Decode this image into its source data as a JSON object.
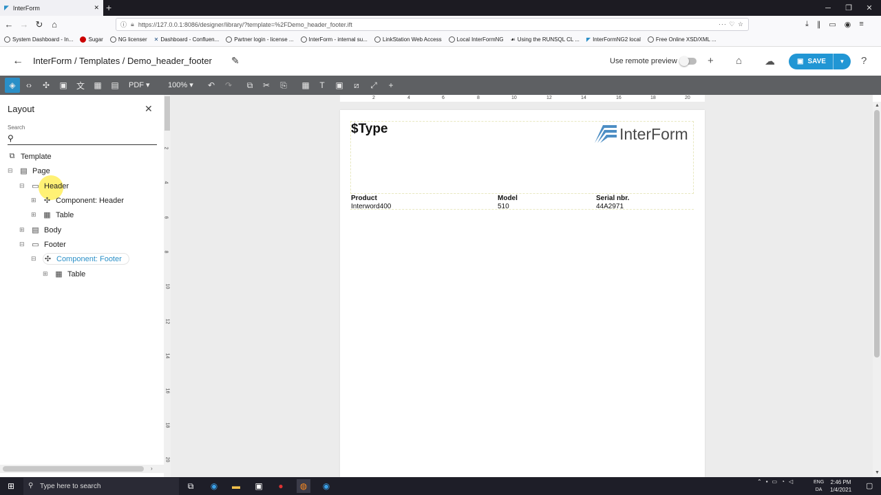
{
  "browser": {
    "tab_title": "InterForm",
    "url": "https://127.0.0.1:8086/designer/library/?template=%2FDemo_header_footer.ift",
    "bookmarks": [
      "System Dashboard - In...",
      "Sugar",
      "NG licenser",
      "Dashboard - Confluen...",
      "Partner login - license ...",
      "InterForm - internal su...",
      "LinkStation Web Access",
      "Local InterFormNG",
      "Using the RUNSQL CL ...",
      "InterFormNG2 local",
      "Free Online XSD/XML ..."
    ]
  },
  "app": {
    "breadcrumb": "InterForm / Templates / Demo_header_footer",
    "remote_preview_label": "Use remote preview",
    "remote_preview_on": false,
    "save_label": "SAVE",
    "accent_color": "#2196d4"
  },
  "toolbar": {
    "format": "PDF",
    "zoom": "100%"
  },
  "layout_panel": {
    "title": "Layout",
    "search_label": "Search",
    "tree": {
      "template": "Template",
      "page": "Page",
      "header": "Header",
      "component_header": "Component: Header",
      "header_table": "Table",
      "body": "Body",
      "footer": "Footer",
      "component_footer": "Component: Footer",
      "footer_table": "Table"
    }
  },
  "ruler": {
    "h_ticks": [
      "2",
      "4",
      "6",
      "8",
      "10",
      "12",
      "14",
      "16",
      "18",
      "20"
    ],
    "v_ticks": [
      "2",
      "4",
      "6",
      "8",
      "10",
      "12",
      "14",
      "16",
      "18",
      "20"
    ]
  },
  "document": {
    "type_field": "$Type",
    "logo_text": "InterForm",
    "columns": [
      "Product",
      "Model",
      "Serial nbr."
    ],
    "row": [
      "Interword400",
      "510",
      "44A2971"
    ]
  },
  "taskbar": {
    "search_placeholder": "Type here to search",
    "time": "2:46 PM",
    "date": "1/4/2021",
    "lang1": "ENG",
    "lang2": "DA"
  }
}
